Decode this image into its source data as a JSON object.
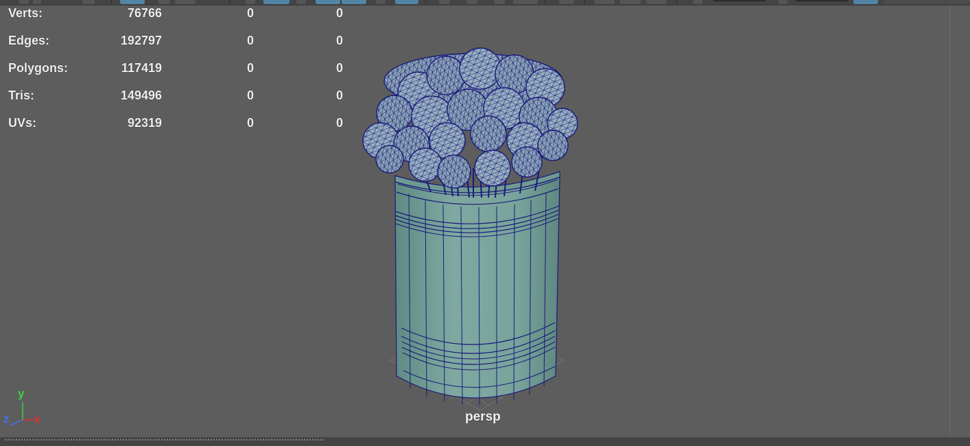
{
  "hud": {
    "rows": [
      {
        "label": "Verts:",
        "v1": "76766",
        "v2": "0",
        "v3": "0"
      },
      {
        "label": "Edges:",
        "v1": "192797",
        "v2": "0",
        "v3": "0"
      },
      {
        "label": "Polygons:",
        "v1": "117419",
        "v2": "0",
        "v3": "0"
      },
      {
        "label": "Tris:",
        "v1": "149496",
        "v2": "0",
        "v3": "0"
      },
      {
        "label": "UVs:",
        "v1": "92319",
        "v2": "0",
        "v3": "0"
      }
    ]
  },
  "viewport": {
    "camera": "persp",
    "axis": {
      "y": "y",
      "z": "z",
      "x": "x"
    }
  },
  "colors": {
    "background": "#5d5d5d",
    "wireframe": "#1a1a7a",
    "bucket_fill": "#76a198",
    "rose_fill": "#8ea8b6",
    "axis_x": "#e03030",
    "axis_y": "#40d040",
    "axis_z": "#4a6cf0"
  }
}
